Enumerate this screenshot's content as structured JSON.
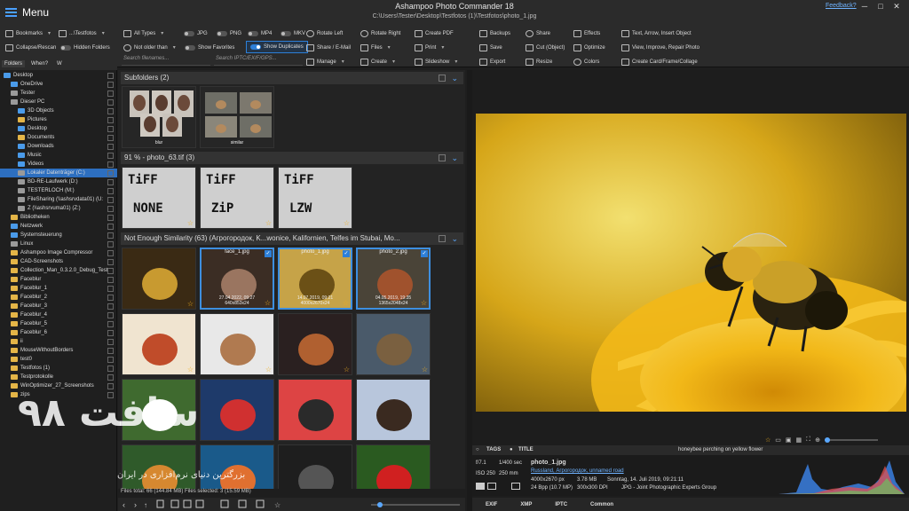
{
  "app": {
    "menu_label": "Menu",
    "title": "Ashampoo Photo Commander 18",
    "path": "C:\\Users\\Tester\\Desktop\\Testfotos (1)\\Testfotos\\photo_1.jpg",
    "feedback": "Feedback?"
  },
  "toolbar": {
    "bookmarks": "Bookmarks",
    "path_short": "...\\Testfotos",
    "collapse": "Collapse/Rescan",
    "hidden_folders": "Hidden Folders",
    "all_types": "All Types",
    "jpg": "JPG",
    "png": "PNG",
    "mp4": "MP4",
    "mkv": "MKV",
    "not_older": "Not older than",
    "show_favorites": "Show Favorites",
    "show_duplicates": "Show Duplicates",
    "search_filenames": "Search filenames...",
    "search_iptc": "Search IPTC/EXIF/GPS...",
    "rotate_left": "Rotate Left",
    "share_email": "Share / E-Mail",
    "manage": "Manage",
    "rotate_right": "Rotate Right",
    "files": "Files",
    "create": "Create",
    "create_pdf": "Create PDF",
    "print": "Print",
    "slideshow": "Slideshow",
    "backups": "Backups",
    "save": "Save",
    "export": "Export",
    "share": "Share",
    "cut_object": "Cut (Object)",
    "resize": "Resize",
    "effects": "Effects",
    "optimize": "Optimize",
    "colors": "Colors",
    "text_arrow": "Text, Arrow, Insert Object",
    "view_improve": "View, Improve, Repair Photo",
    "create_card": "Create Card/Frame/Collage"
  },
  "left": {
    "tabs": [
      "Folders",
      "When?",
      "W"
    ],
    "tree": [
      {
        "label": "Desktop",
        "indent": 0,
        "kind": "blue"
      },
      {
        "label": "OneDrive",
        "indent": 1,
        "kind": "blue"
      },
      {
        "label": "Tester",
        "indent": 1,
        "kind": "gray"
      },
      {
        "label": "Dieser PC",
        "indent": 1,
        "kind": "gray"
      },
      {
        "label": "3D Objects",
        "indent": 2,
        "kind": "blue"
      },
      {
        "label": "Pictures",
        "indent": 2,
        "kind": "yellow"
      },
      {
        "label": "Desktop",
        "indent": 2,
        "kind": "blue"
      },
      {
        "label": "Documents",
        "indent": 2,
        "kind": "yellow"
      },
      {
        "label": "Downloads",
        "indent": 2,
        "kind": "blue"
      },
      {
        "label": "Music",
        "indent": 2,
        "kind": "blue"
      },
      {
        "label": "Videos",
        "indent": 2,
        "kind": "blue"
      },
      {
        "label": "Lokaler Datenträger (C:)",
        "indent": 2,
        "kind": "gray",
        "selected": true
      },
      {
        "label": "BD-RE-Laufwerk (D:)",
        "indent": 2,
        "kind": "gray"
      },
      {
        "label": "TESTERLOCH (M:)",
        "indent": 2,
        "kind": "gray"
      },
      {
        "label": "FileSharing (\\\\ashsrvdata01) (U:",
        "indent": 2,
        "kind": "gray"
      },
      {
        "label": "Z (\\\\ashsrvuma01) (Z:)",
        "indent": 2,
        "kind": "gray"
      },
      {
        "label": "Bibliotheken",
        "indent": 1,
        "kind": "yellow"
      },
      {
        "label": "Netzwerk",
        "indent": 1,
        "kind": "blue"
      },
      {
        "label": "Systemsteuerung",
        "indent": 1,
        "kind": "blue"
      },
      {
        "label": "Linux",
        "indent": 1,
        "kind": "gray"
      },
      {
        "label": "Ashampoo Image Compressor",
        "indent": 1,
        "kind": "yellow"
      },
      {
        "label": "CAD-Screenshots",
        "indent": 1,
        "kind": "yellow"
      },
      {
        "label": "Collection_Man_0.3.2.0_Debug_Test",
        "indent": 1,
        "kind": "yellow"
      },
      {
        "label": "Faceblur",
        "indent": 1,
        "kind": "yellow"
      },
      {
        "label": "Faceblur_1",
        "indent": 1,
        "kind": "yellow"
      },
      {
        "label": "Faceblur_2",
        "indent": 1,
        "kind": "yellow"
      },
      {
        "label": "Faceblur_3",
        "indent": 1,
        "kind": "yellow"
      },
      {
        "label": "Faceblur_4",
        "indent": 1,
        "kind": "yellow"
      },
      {
        "label": "Faceblur_5",
        "indent": 1,
        "kind": "yellow"
      },
      {
        "label": "Faceblur_6",
        "indent": 1,
        "kind": "yellow"
      },
      {
        "label": "ii",
        "indent": 1,
        "kind": "yellow"
      },
      {
        "label": "MouseWithoutBorders",
        "indent": 1,
        "kind": "yellow"
      },
      {
        "label": "test0",
        "indent": 1,
        "kind": "yellow"
      },
      {
        "label": "Testfotos (1)",
        "indent": 1,
        "kind": "yellow"
      },
      {
        "label": "Testprotokolle",
        "indent": 1,
        "kind": "yellow"
      },
      {
        "label": "WinOptimizer_27_Screenshots",
        "indent": 1,
        "kind": "yellow"
      },
      {
        "label": "zips",
        "indent": 1,
        "kind": "yellow"
      }
    ]
  },
  "middle": {
    "subfolders_header": "Subfolders  (2)",
    "subfolder_labels": [
      "blur",
      "similar"
    ],
    "group1_header": "91 % - photo_63.tif  (3)",
    "tiff_labels": [
      [
        "TiFF",
        "NONE"
      ],
      [
        "TiFF",
        "ZiP"
      ],
      [
        "TiFF",
        "LZW"
      ]
    ],
    "group2_header": "Not Enough Similarity  (63)  (Агрогородок, K...wonice, Kalifornien, Telfes im Stubai, Mo...",
    "thumbs": [
      {
        "caption": "",
        "meta": ""
      },
      {
        "caption": "face_1.jpg",
        "meta": "27.04.2022, 09:27\n640x853x24"
      },
      {
        "caption": "photo_1.jpg",
        "meta": "14.07.2019, 09:21\n4000x2670x24"
      },
      {
        "caption": "photo_2.jpg",
        "meta": "04.05.2019, 19:35\n1365x2048x24"
      }
    ],
    "status": "Files total: 66 (144.84 MB)    Files selected: 3 (15.59 MB)"
  },
  "right": {
    "tags_label": "TAGS",
    "title_label": "TITLE",
    "title_value": "honeybee perching on yellow flower",
    "exif": {
      "aperture": "f/7.1",
      "shutter": "1/400 sec",
      "iso": "ISO 250",
      "focal": "250 mm",
      "filename": "photo_1.jpg",
      "location": "Russland, Агрогородок, unnamed road",
      "dims": "4000x2670 px",
      "size": "3.78 MB",
      "date": "Sonntag, 14. Juli 2019, 09:21:11",
      "bpp": "24 Bpp (10.7 MP)",
      "dpi": "300x300 DPI",
      "format": "JPG - Joint Photographic Experts Group"
    },
    "tabs": [
      "EXIF",
      "XMP",
      "IPTC",
      "Common"
    ]
  },
  "watermark": {
    "big": "سافت ۹۸",
    "small": "بزرگترین دنیای نرم‌افزاری در ایران"
  }
}
